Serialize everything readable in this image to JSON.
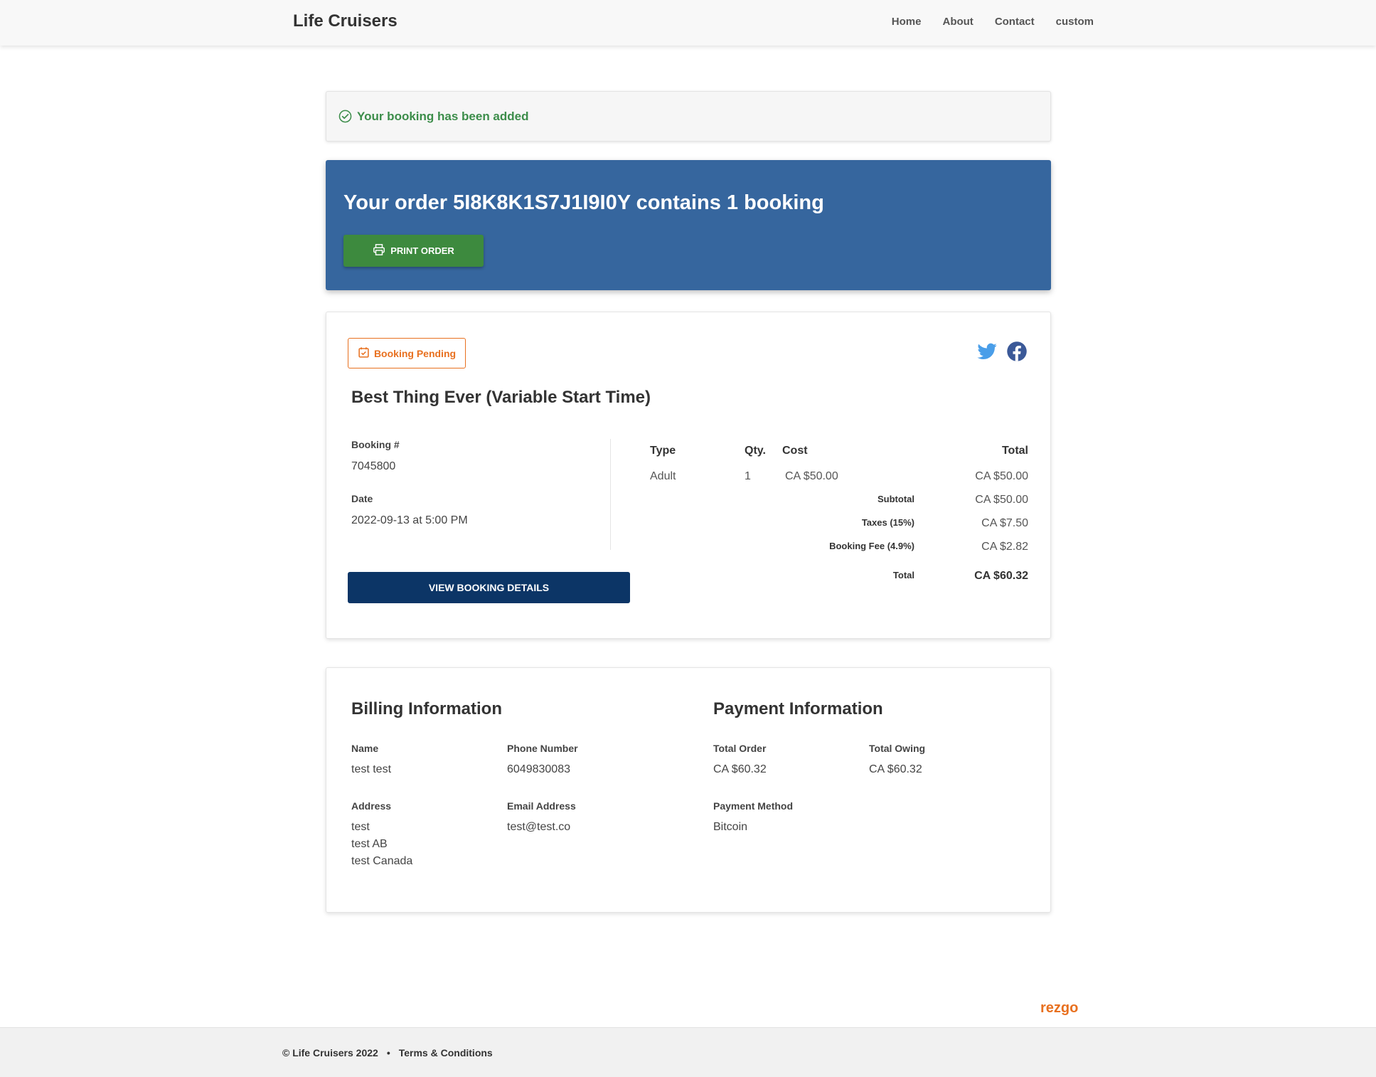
{
  "header": {
    "brand": "Life Cruisers",
    "nav": [
      "Home",
      "About",
      "Contact",
      "custom"
    ]
  },
  "alert": {
    "text": "Your booking has been added"
  },
  "order": {
    "title": "Your order 5I8K8K1S7J1I9I0Y contains 1 booking",
    "print_label": "PRINT ORDER"
  },
  "booking": {
    "status": "Booking Pending",
    "item_title": "Best Thing Ever (Variable Start Time)",
    "booking_number_label": "Booking #",
    "booking_number": "7045800",
    "date_label": "Date",
    "date": "2022-09-13 at 5:00 PM",
    "view_label": "VIEW BOOKING DETAILS",
    "table": {
      "headers": {
        "type": "Type",
        "qty": "Qty.",
        "cost": "Cost",
        "total": "Total"
      },
      "rows": [
        {
          "type": "Adult",
          "qty": "1",
          "cost": "CA $50.00",
          "total": "CA $50.00"
        }
      ],
      "subtotal_label": "Subtotal",
      "subtotal": "CA $50.00",
      "taxes_label": "Taxes (15%)",
      "taxes": "CA $7.50",
      "fee_label": "Booking Fee (4.9%)",
      "fee": "CA $2.82",
      "total_label": "Total",
      "total": "CA $60.32"
    }
  },
  "billing": {
    "title": "Billing Information",
    "name_label": "Name",
    "name": "test test",
    "phone_label": "Phone Number",
    "phone": "6049830083",
    "address_label": "Address",
    "address_lines": [
      "test",
      "test AB",
      "test Canada"
    ],
    "email_label": "Email Address",
    "email": "test@test.co"
  },
  "payment": {
    "title": "Payment Information",
    "total_order_label": "Total Order",
    "total_order": "CA $60.32",
    "total_owing_label": "Total Owing",
    "total_owing": "CA $60.32",
    "method_label": "Payment Method",
    "method": "Bitcoin"
  },
  "footer": {
    "copyright": "© Life Cruisers 2022",
    "separator": "•",
    "terms": "Terms & Conditions",
    "powered_by": "rezgo"
  },
  "colors": {
    "banner": "#36669e",
    "success": "#3c8d4a",
    "print_button": "#3d8a3e",
    "pending": "#e8701f",
    "view_button": "#0c3566"
  }
}
